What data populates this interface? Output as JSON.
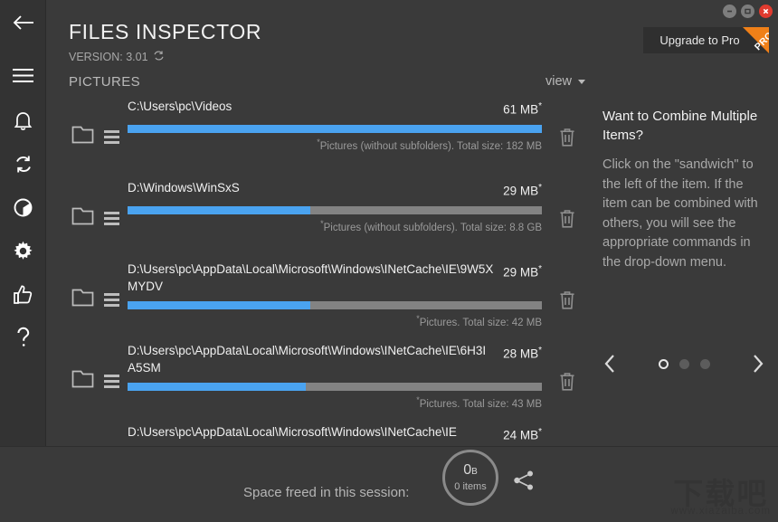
{
  "window": {
    "minimize_label": "Minimize",
    "maximize_label": "Maximize",
    "close_label": "Close"
  },
  "header": {
    "title": "FILES INSPECTOR",
    "version": "VERSION: 3.01",
    "section": "PICTURES",
    "view_label": "view",
    "upgrade_label": "Upgrade to Pro",
    "pro_badge": "PRO",
    "accent_color": "#4aa3f0",
    "pro_color": "#f08018"
  },
  "sidebar": {
    "items": [
      {
        "name": "back",
        "label": "Back"
      },
      {
        "name": "menu",
        "label": "Menu"
      },
      {
        "name": "notifications",
        "label": "Notifications"
      },
      {
        "name": "refresh",
        "label": "Refresh"
      },
      {
        "name": "analysis",
        "label": "Disk analysis"
      },
      {
        "name": "settings",
        "label": "Settings"
      },
      {
        "name": "feedback",
        "label": "Feedback"
      },
      {
        "name": "help",
        "label": "Help"
      }
    ]
  },
  "files": [
    {
      "path": "C:\\Users\\pc\\Videos",
      "size": "61 MB",
      "fill_percent": 100,
      "separator_percent": null,
      "note": "Pictures (without subfolders). Total size: 182 MB"
    },
    {
      "path": "D:\\Windows\\WinSxS",
      "size": "29 MB",
      "fill_percent": 44,
      "separator_percent": 45.5,
      "note": "Pictures (without subfolders). Total size: 8.8 GB"
    },
    {
      "path": "D:\\Users\\pc\\AppData\\Local\\Microsoft\\Windows\\INetCache\\IE\\9W5XMYDV",
      "size": "29 MB",
      "fill_percent": 44,
      "separator_percent": null,
      "note": "Pictures. Total size: 42 MB"
    },
    {
      "path": "D:\\Users\\pc\\AppData\\Local\\Microsoft\\Windows\\INetCache\\IE\\6H3IA5SM",
      "size": "28 MB",
      "fill_percent": 43,
      "separator_percent": null,
      "note": "Pictures. Total size: 43 MB"
    },
    {
      "path": "D:\\Users\\pc\\AppData\\Local\\Microsoft\\Windows\\INetCache\\IE",
      "size": "24 MB",
      "fill_percent": 0,
      "separator_percent": null,
      "note": ""
    }
  ],
  "tip": {
    "title": "Want to Combine Multiple Items?",
    "body": "Click on the \"sandwich\" to the left of the item. If the item can be combined with others, you will see the appropriate commands in the drop-down menu."
  },
  "pagination": {
    "prev_label": "Previous",
    "next_label": "Next",
    "total_dots": 3,
    "active_index": 0
  },
  "footer": {
    "freed_label": "Space freed in this session:",
    "freed_value": "0",
    "freed_unit": "B",
    "freed_items": "0 items",
    "share_label": "Share"
  },
  "watermark": {
    "main": "下载吧",
    "sub": "www.xiazaiba.com"
  }
}
